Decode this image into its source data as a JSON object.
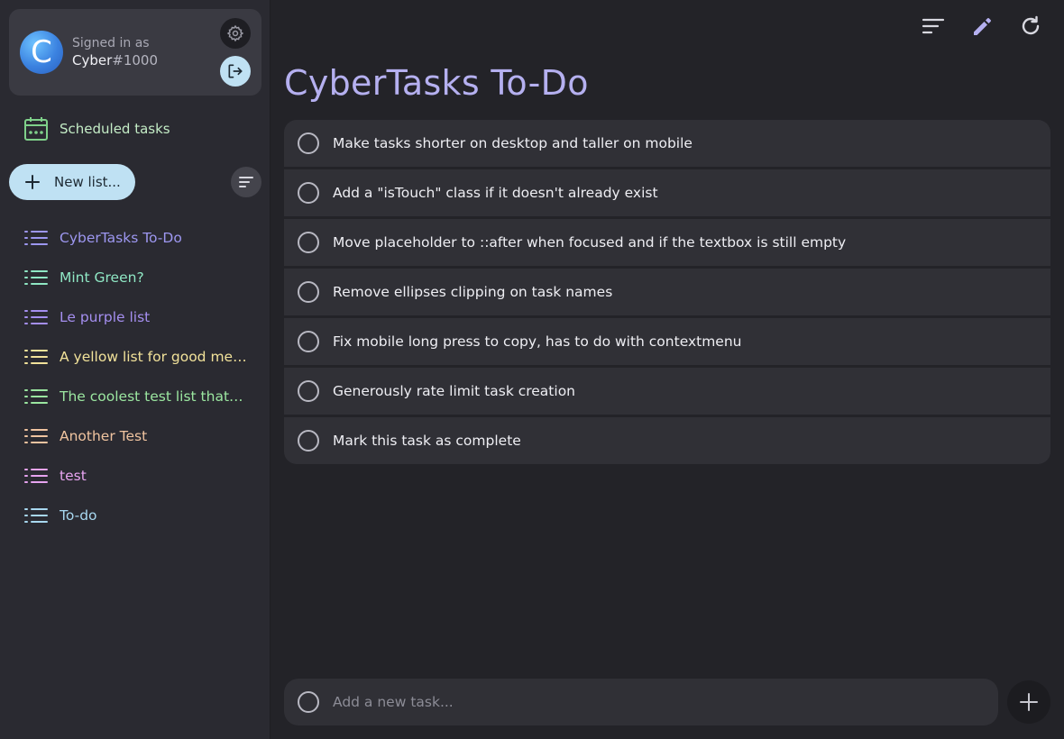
{
  "user": {
    "avatar_letter": "C",
    "signed_in_label": "Signed in as",
    "name": "Cyber",
    "tag": "#1000"
  },
  "sidebar": {
    "scheduled_label": "Scheduled tasks",
    "new_list_label": "New list...",
    "lists": [
      {
        "name": "CyberTasks To-Do",
        "color": "#9d97f0"
      },
      {
        "name": "Mint Green?",
        "color": "#8fe7c4"
      },
      {
        "name": "Le purple list",
        "color": "#a58ff0"
      },
      {
        "name": "A yellow list for good measure",
        "color": "#f2e29a"
      },
      {
        "name": "The coolest test list that ever existed",
        "color": "#9be6a0"
      },
      {
        "name": "Another Test",
        "color": "#f0c4a0"
      },
      {
        "name": "test",
        "color": "#e7a4f0"
      },
      {
        "name": "To-do",
        "color": "#a8d8f0"
      }
    ]
  },
  "main": {
    "title": "CyberTasks To-Do",
    "tasks": [
      "Make tasks shorter on desktop and taller on mobile",
      "Add a \"isTouch\" class if it doesn't already exist",
      "Move placeholder to ::after when focused and if the textbox is still empty",
      "Remove ellipses clipping on task names",
      "Fix mobile long press to copy, has to do with contextmenu",
      "Generously rate limit task creation",
      "Mark this task as complete"
    ],
    "add_placeholder": "Add a new task..."
  },
  "colors": {
    "accent": "#b5b0f0",
    "scheduled": "#7fd08a",
    "button_light": "#bfe1f3"
  },
  "icons": {
    "settings": "gear-icon",
    "logout": "logout-icon",
    "scheduled": "calendar-icon",
    "new_list": "plus-icon",
    "sort": "sort-icon",
    "list": "list-icon",
    "edit": "pencil-icon",
    "refresh": "refresh-icon",
    "add": "plus-icon"
  }
}
